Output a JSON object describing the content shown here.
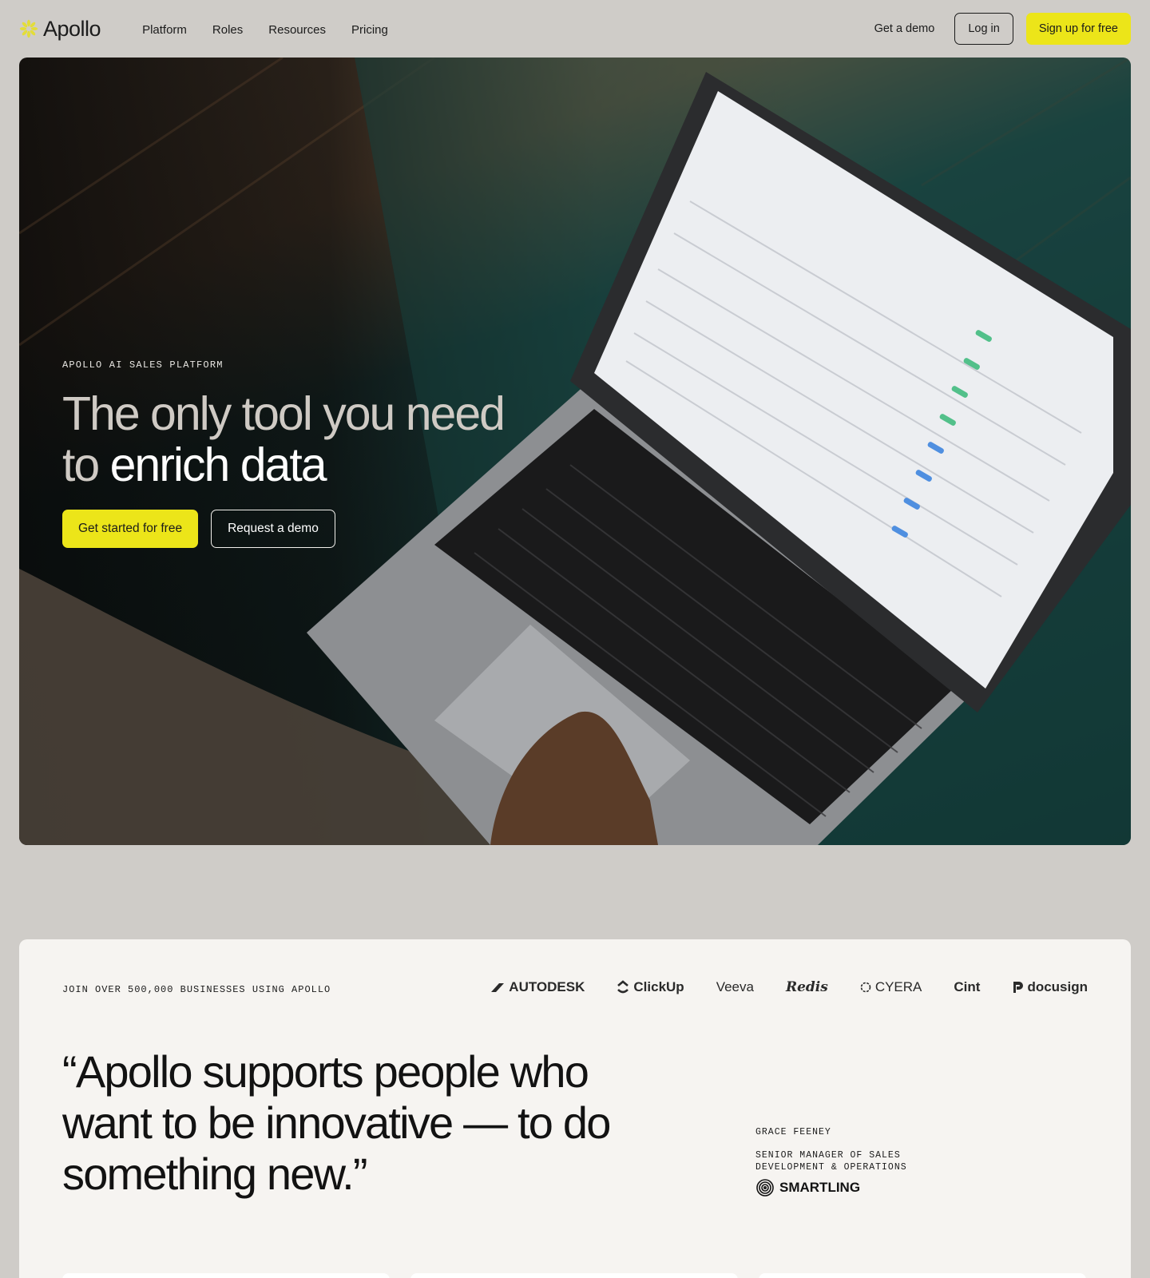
{
  "nav": {
    "brand": "Apollo",
    "menu": [
      "Platform",
      "Roles",
      "Resources",
      "Pricing"
    ],
    "demo_label": "Get a demo",
    "login_label": "Log in",
    "signup_label": "Sign up for free"
  },
  "hero": {
    "eyebrow": "APOLLO AI SALES PLATFORM",
    "title_line1": "The only tool you need",
    "title_prefix": "to ",
    "title_emphasis": "enrich data",
    "primary_cta": "Get started for free",
    "secondary_cta": "Request a demo",
    "image_icon": "laptop-app-screenshot"
  },
  "proof": {
    "eyebrow": "JOIN OVER 500,000 BUSINESSES USING APOLLO",
    "logos": [
      "AUTODESK",
      "ClickUp",
      "Veeva",
      "Redis",
      "CYERA",
      "Cint",
      "docusign"
    ],
    "quote": "“Apollo supports people who want to be innovative — to do something new.”",
    "author_name": "GRACE FEENEY",
    "author_role": "SENIOR MANAGER OF SALES DEVELOPMENT & OPERATIONS",
    "author_company": "SMARTLING"
  },
  "colors": {
    "page_bg": "#cfccc8",
    "accent_yellow": "#ece519",
    "card_bg": "#f6f4f1",
    "text": "#1b1b1b"
  }
}
